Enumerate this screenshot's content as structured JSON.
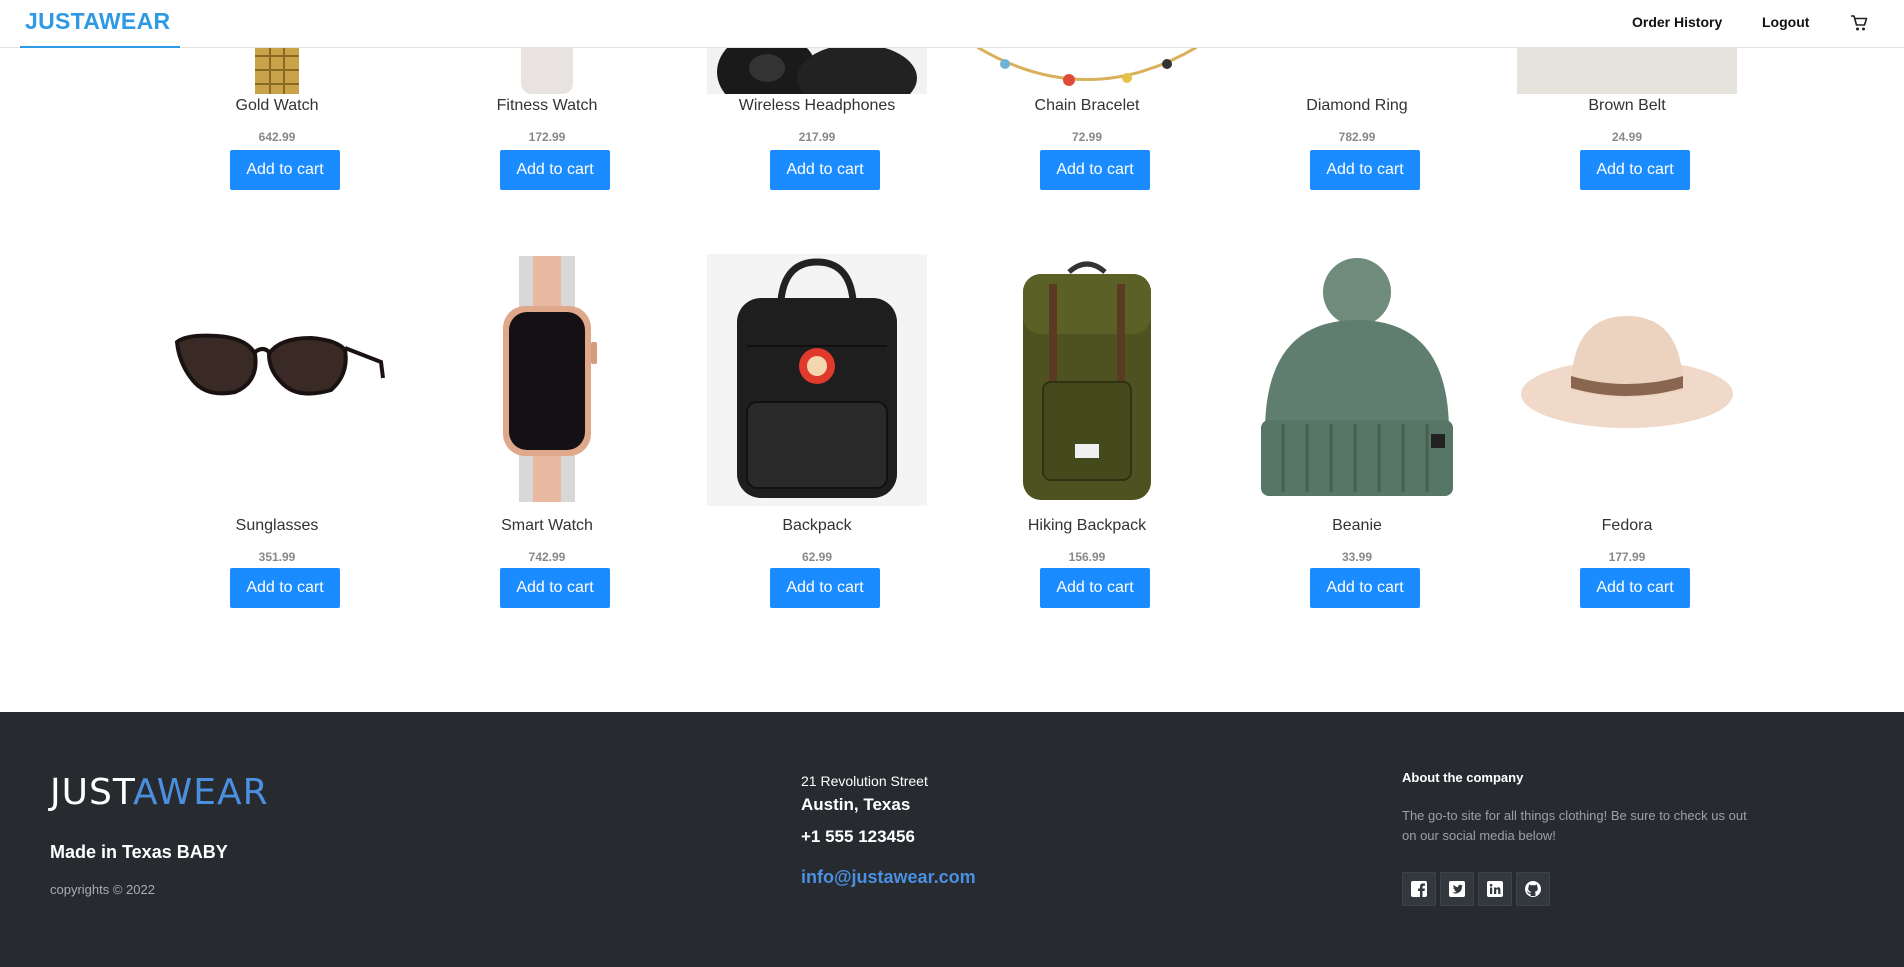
{
  "header": {
    "brand": "JUSTAWEAR",
    "links": [
      "Order History",
      "Logout"
    ]
  },
  "products_row1": [
    {
      "name": "Gold Watch",
      "price": "642.99",
      "button": "Add to cart"
    },
    {
      "name": "Fitness Watch",
      "price": "172.99",
      "button": "Add to cart"
    },
    {
      "name": "Wireless Headphones",
      "price": "217.99",
      "button": "Add to cart"
    },
    {
      "name": "Chain Bracelet",
      "price": "72.99",
      "button": "Add to cart"
    },
    {
      "name": "Diamond Ring",
      "price": "782.99",
      "button": "Add to cart"
    },
    {
      "name": "Brown Belt",
      "price": "24.99",
      "button": "Add to cart"
    }
  ],
  "products_row2": [
    {
      "name": "Sunglasses",
      "price": "351.99",
      "button": "Add to cart"
    },
    {
      "name": "Smart Watch",
      "price": "742.99",
      "button": "Add to cart"
    },
    {
      "name": "Backpack",
      "price": "62.99",
      "button": "Add to cart"
    },
    {
      "name": "Hiking Backpack",
      "price": "156.99",
      "button": "Add to cart"
    },
    {
      "name": "Beanie",
      "price": "33.99",
      "button": "Add to cart"
    },
    {
      "name": "Fedora",
      "price": "177.99",
      "button": "Add to cart"
    }
  ],
  "footer": {
    "logo_a": "JUST",
    "logo_b": "AWEAR",
    "tagline": "Made in Texas BABY",
    "copyright": "copyrights © 2022",
    "street": "21 Revolution Street",
    "city": "Austin, Texas",
    "phone": "+1 555 123456",
    "email": "info@justawear.com",
    "about_heading": "About the company",
    "about_text": "The go-to site for all things clothing! Be sure to check us out on our social media below!",
    "social_icons": [
      "facebook-icon",
      "twitter-icon",
      "linkedin-icon",
      "github-icon"
    ]
  },
  "colors": {
    "brand": "#2e9ae6",
    "button": "#1a8cff",
    "footer_bg": "#272b30",
    "link_blue": "#4a8fe0"
  }
}
